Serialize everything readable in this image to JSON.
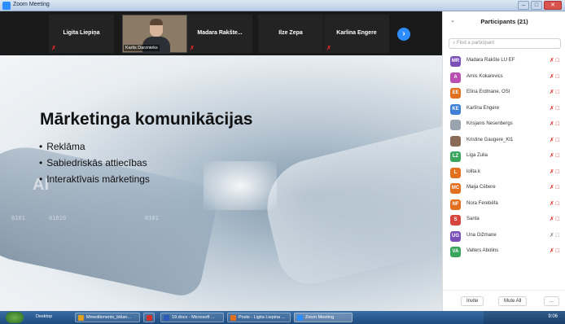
{
  "window": {
    "title": "Zoom Meeting"
  },
  "video_strip": {
    "tiles": [
      {
        "name": "Ligita Liepiņa",
        "muted": true
      },
      {
        "name": "Karlis Darznieks",
        "muted": false,
        "active": true
      },
      {
        "name": "Madara Rakšte...",
        "muted": true
      },
      {
        "name": "Ilze Zepa",
        "muted": false
      },
      {
        "name": "Karlina Engere",
        "muted": true
      }
    ]
  },
  "slide": {
    "title": "Mārketinga komunikācijas",
    "bullets": [
      "Reklāma",
      "Sabiedriskās attiecības",
      "Interaktīvais mārketings"
    ],
    "bg_ai": "AI",
    "bg_code": [
      "0101",
      "01010",
      "0101"
    ]
  },
  "participants": {
    "title": "Participants (21)",
    "search_placeholder": "Find a participant",
    "list": [
      {
        "initials": "MR",
        "name": "Madara Rakšte LU EF",
        "color": "#7b4fb8"
      },
      {
        "initials": "A",
        "name": "Arnis Kokarevics",
        "color": "#b84fb1"
      },
      {
        "initials": "EE",
        "name": "Elīna Erdmane, OSI",
        "color": "#e2701e"
      },
      {
        "initials": "KE",
        "name": "Karlīna Engere",
        "color": "#3f7fd6"
      },
      {
        "initials": "",
        "name": "Krisjanis Nesenbergs",
        "color": "#9aa4ae",
        "photo": true
      },
      {
        "initials": "",
        "name": "Kristine Gaugere_Kt1",
        "color": "#8a6b55",
        "photo": true
      },
      {
        "initials": "LZ",
        "name": "Liga Zulia",
        "color": "#3aa55d"
      },
      {
        "initials": "L",
        "name": "lolita.k",
        "color": "#e2701e"
      },
      {
        "initials": "MC",
        "name": "Maija Cēbere",
        "color": "#e2701e"
      },
      {
        "initials": "NF",
        "name": "Nora Ferebēfa",
        "color": "#e2701e"
      },
      {
        "initials": "S",
        "name": "Santa",
        "color": "#d6453e"
      },
      {
        "initials": "UG",
        "name": "Una Gižmane",
        "color": "#7b4fb8"
      },
      {
        "initials": "VA",
        "name": "Valters Abolins",
        "color": "#3aa55d"
      }
    ],
    "invite_label": "Invite",
    "mute_all_label": "Mute All",
    "more_label": "..."
  },
  "taskbar": {
    "desktop_label": "Desktop",
    "items": [
      {
        "label": "Mmedikments_bklan...",
        "color": "#e0a020"
      },
      {
        "label": "",
        "color": "#d0302a"
      },
      {
        "label": "19.docx - Microsoft ...",
        "color": "#2a5bb8"
      },
      {
        "label": "Posts - Ligita Liepina ...",
        "color": "#e07020"
      },
      {
        "label": "Zoom Meeting",
        "color": "#2d8cff"
      }
    ],
    "clock": "9:06"
  }
}
